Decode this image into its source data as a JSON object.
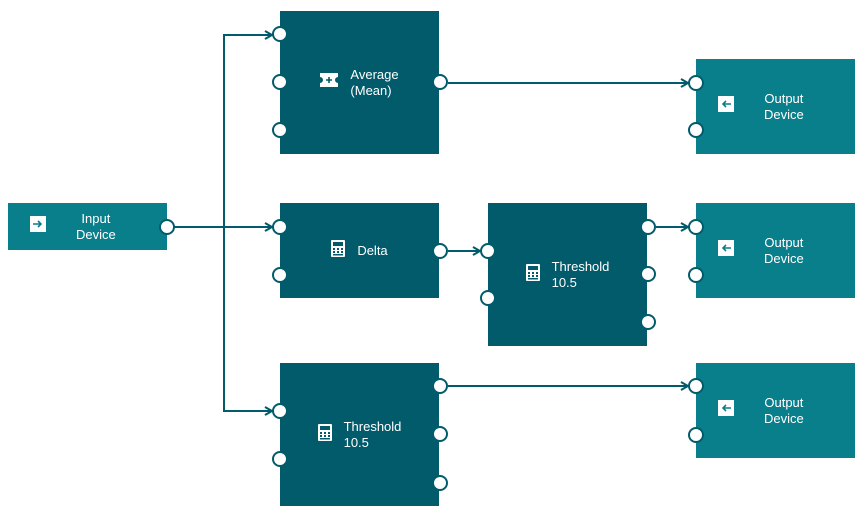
{
  "diagram": {
    "colors": {
      "io_node": "#0a7f8c",
      "op_node": "#025b6b",
      "edge": "#025b6b",
      "port_fill": "#ffffff",
      "text": "#ffffff"
    },
    "nodes": [
      {
        "id": "input",
        "kind": "io",
        "icon": "input-arrow-icon",
        "label_line1": "Input",
        "label_line2": "Device"
      },
      {
        "id": "average",
        "kind": "op",
        "icon": "ticket-plus-icon",
        "label_line1": "Average",
        "label_line2": "(Mean)"
      },
      {
        "id": "delta",
        "kind": "op",
        "icon": "calculator-icon",
        "label_line1": "Delta",
        "label_line2": ""
      },
      {
        "id": "threshold_mid",
        "kind": "op",
        "icon": "calculator-icon",
        "label_line1": "Threshold",
        "label_line2": "10.5"
      },
      {
        "id": "threshold_bottom",
        "kind": "op",
        "icon": "calculator-icon",
        "label_line1": "Threshold",
        "label_line2": "10.5"
      },
      {
        "id": "output_top",
        "kind": "io",
        "icon": "output-arrow-icon",
        "label_line1": "Output",
        "label_line2": "Device"
      },
      {
        "id": "output_mid",
        "kind": "io",
        "icon": "output-arrow-icon",
        "label_line1": "Output",
        "label_line2": "Device"
      },
      {
        "id": "output_bottom",
        "kind": "io",
        "icon": "output-arrow-icon",
        "label_line1": "Output",
        "label_line2": "Device"
      }
    ],
    "edges": [
      {
        "from": "input.out0",
        "to": "average.in0"
      },
      {
        "from": "input.out0",
        "to": "delta.in0"
      },
      {
        "from": "input.out0",
        "to": "threshold_bottom.in0"
      },
      {
        "from": "average.out0",
        "to": "output_top.in0"
      },
      {
        "from": "delta.out0",
        "to": "threshold_mid.in0"
      },
      {
        "from": "threshold_mid.out0",
        "to": "output_mid.in0"
      },
      {
        "from": "threshold_bottom.out0",
        "to": "output_bottom.in0"
      }
    ]
  }
}
